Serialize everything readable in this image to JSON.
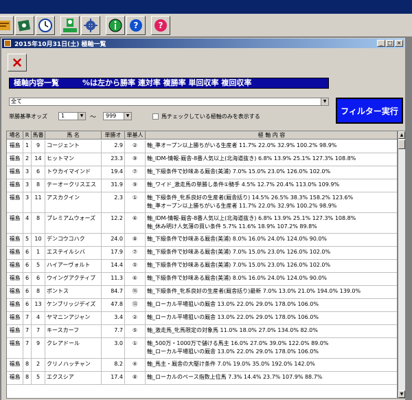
{
  "window": {
    "title": "2015年10月31日(土) 極軸一覧"
  },
  "banner": {
    "label": "極軸内容一覧",
    "legend": "%は左から勝率 連対率 複勝率 単回収率 複回収率"
  },
  "filter": {
    "selected": "全て",
    "odds_label": "単勝基準オッズ",
    "odds_min": "1",
    "tilde": "～",
    "odds_max": "999",
    "checkbox_label": "馬チェックしている極軸のみを表示する",
    "run_button": "フィルター実行"
  },
  "table": {
    "headers": [
      "場名",
      "R",
      "馬番",
      "馬 名",
      "単勝オ",
      "単基人",
      "極 軸 内 容"
    ],
    "rows": [
      {
        "venue": "福島",
        "race": "1",
        "num": "9",
        "name": "コージェント",
        "odds": "2.9",
        "rank": "②",
        "content": [
          "軸_準オープン以上勝ちがいる生産者 11.7% 22.0% 32.9% 100.2% 98.9%"
        ]
      },
      {
        "venue": "福島",
        "race": "2",
        "num": "14",
        "name": "ヒットマン",
        "odds": "23.3",
        "rank": "⑨",
        "content": [
          "軸_IDM-情報-厩舎-8番人気以上(北海道抜き) 6.8% 13.9% 25.1% 127.3% 108.8%"
        ]
      },
      {
        "venue": "福島",
        "race": "3",
        "num": "6",
        "name": "トウカイマインド",
        "odds": "19.4",
        "rank": "⑦",
        "content": [
          "軸_下級条件で妙味ある厩舎(美浦) 7.0% 15.0% 23.0% 126.0% 102.0%"
        ]
      },
      {
        "venue": "福島",
        "race": "3",
        "num": "8",
        "name": "テーオークリスエス",
        "odds": "31.9",
        "rank": "⑨",
        "content": [
          "軸_ワイド_激走馬の単勝し条件①騎手 4.5% 12.7% 20.4% 113.0% 109.9%"
        ]
      },
      {
        "venue": "福島",
        "race": "3",
        "num": "11",
        "name": "アスカクイン",
        "odds": "2.3",
        "rank": "①",
        "content": [
          "軸_下級条件_牝系良好の生産者(厩舎括り) 14.5% 26.5% 38.3% 158.2% 123.6%",
          "軸_準オープン以上勝ちがいる生産者 11.7% 22.0% 32.9% 100.2% 98.9%"
        ]
      },
      {
        "venue": "福島",
        "race": "4",
        "num": "8",
        "name": "プレミアムウォーズ",
        "odds": "12.2",
        "rank": "⑥",
        "content": [
          "軸_IDM-情報-厩舎-8番人気以上(北海道抜き) 6.8% 13.9% 25.1% 127.3% 108.8%",
          "軸_休み明け人気薄の買い条件 5.7% 11.6% 18.9% 107.2% 89.8%"
        ]
      },
      {
        "venue": "福島",
        "race": "5",
        "num": "10",
        "name": "デンコウコハク",
        "odds": "24.0",
        "rank": "⑧",
        "content": [
          "軸_下級条件で妙味ある厩舎(美浦) 8.0% 16.0% 24.0% 124.0% 90.0%"
        ]
      },
      {
        "venue": "福島",
        "race": "6",
        "num": "1",
        "name": "エステイルシバ",
        "odds": "17.9",
        "rank": "⑦",
        "content": [
          "軸_下級条件で妙味ある厩舎(美浦) 7.0% 15.0% 23.0% 126.0% 102.0%"
        ]
      },
      {
        "venue": "福島",
        "race": "6",
        "num": "5",
        "name": "ハイアーヴォルト",
        "odds": "14.4",
        "rank": "⑤",
        "content": [
          "軸_下級条件で妙味ある厩舎(美浦) 7.0% 15.0% 23.0% 126.0% 102.0%"
        ]
      },
      {
        "venue": "福島",
        "race": "6",
        "num": "6",
        "name": "ウイングアクティブ",
        "odds": "11.3",
        "rank": "⑥",
        "content": [
          "軸_下級条件で妙味ある厩舎(美浦) 8.0% 16.0% 24.0% 124.0% 90.0%"
        ]
      },
      {
        "venue": "福島",
        "race": "6",
        "num": "8",
        "name": "ポントス",
        "odds": "84.7",
        "rank": "⑮",
        "content": [
          "軸_下級条件_牝系良好の生産者(厩舎括り)最新 7.0% 13.0% 21.0% 194.0% 139.0%"
        ]
      },
      {
        "venue": "福島",
        "race": "6",
        "num": "13",
        "name": "ケンブリッジデイズ",
        "odds": "47.8",
        "rank": "⑬",
        "content": [
          "軸_ローカル平場狙いの厩舎 13.0% 22.0% 29.0% 178.0% 106.0%"
        ]
      },
      {
        "venue": "福島",
        "race": "7",
        "num": "4",
        "name": "ヤマニンアジャン",
        "odds": "3.4",
        "rank": "②",
        "content": [
          "軸_ローカル平場狙いの厩舎 13.0% 22.0% 29.0% 178.0% 106.0%"
        ]
      },
      {
        "venue": "福島",
        "race": "7",
        "num": "7",
        "name": "キースカーフ",
        "odds": "7.7",
        "rank": "⑤",
        "content": [
          "軸_激走馬_牝馬限定の対象馬 11.0% 18.0% 27.0% 134.0% 82.0%"
        ]
      },
      {
        "venue": "福島",
        "race": "7",
        "num": "9",
        "name": "クレアドール",
        "odds": "3.0",
        "rank": "①",
        "content": [
          "軸_500万・1000万で儲ける馬主 16.0% 27.0% 39.0% 122.0% 89.0%",
          "軸_ローカル平場狙いの厩舎 13.0% 22.0% 29.0% 178.0% 106.0%"
        ]
      },
      {
        "venue": "福島",
        "race": "8",
        "num": "2",
        "name": "クリノハッチャン",
        "odds": "8.2",
        "rank": "④",
        "content": [
          "軸_馬主・厩舎の大駆け条件 7.0% 19.0% 35.0% 192.0% 142.0%"
        ]
      },
      {
        "venue": "福島",
        "race": "8",
        "num": "5",
        "name": "エクスシア",
        "odds": "17.4",
        "rank": "⑧",
        "content": [
          "軸_ローカルのペース指数上位馬 7.3% 14.4% 23.7% 107.9% 88.7%"
        ]
      }
    ]
  },
  "colors": {
    "title_start": "#0a246a",
    "banner": "#0a0aa0",
    "button": "#0a1af0",
    "close_x": "#cc0000"
  }
}
